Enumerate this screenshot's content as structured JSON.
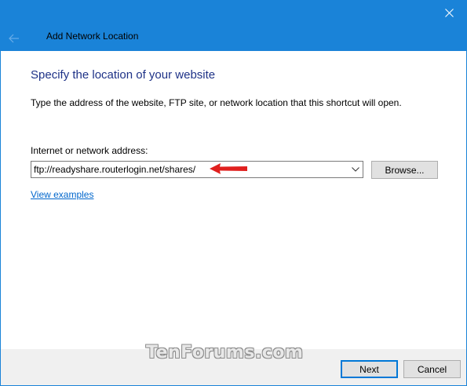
{
  "window": {
    "accent_color": "#1a83d8",
    "close_icon": "close-icon"
  },
  "header": {
    "back_icon": "back-arrow-icon",
    "title": "Add Network Location"
  },
  "main": {
    "heading": "Specify the location of your website",
    "description": "Type the address of the website, FTP site, or network location that this shortcut will open.",
    "address_label": "Internet or network address:",
    "address_value": "ftp://readyshare.routerlogin.net/shares/",
    "browse_label": "Browse...",
    "view_examples_label": "View examples",
    "annotation_arrow_color": "#e0201e"
  },
  "footer": {
    "watermark": "TenForums.com",
    "next_label": "Next",
    "cancel_label": "Cancel"
  }
}
